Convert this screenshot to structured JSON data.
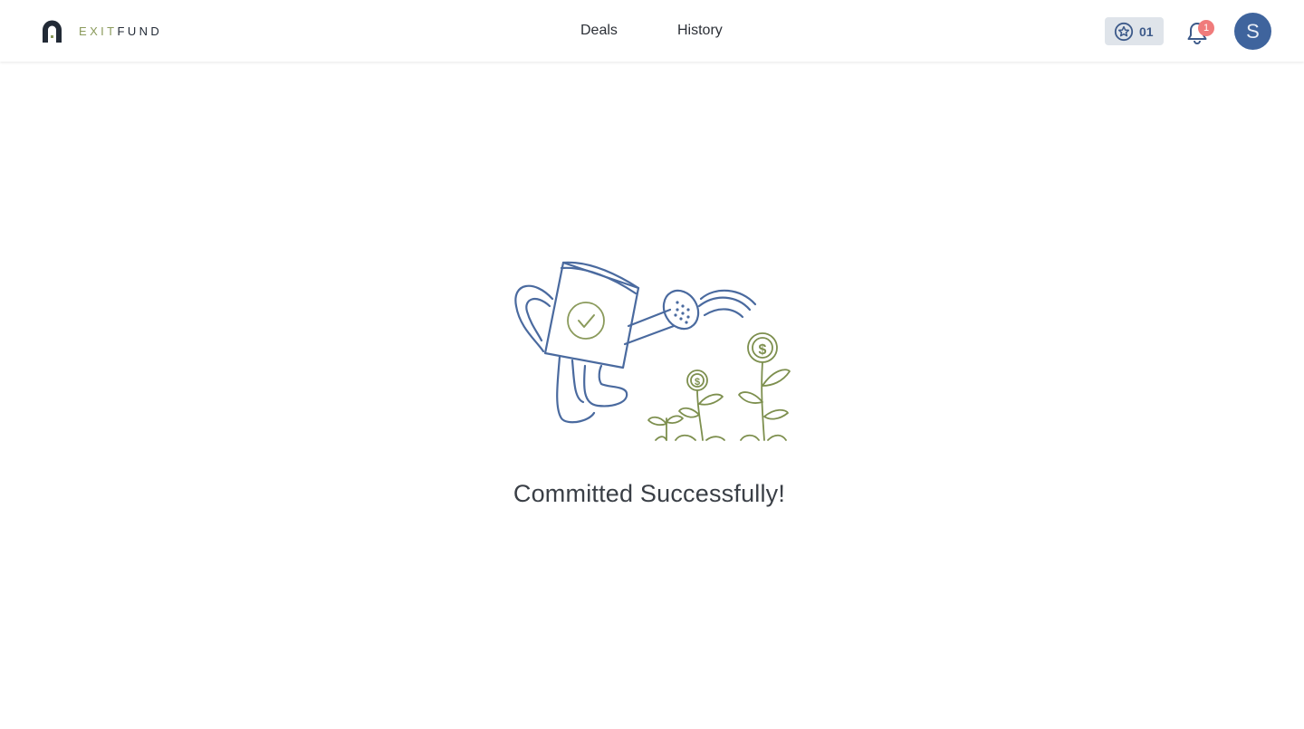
{
  "header": {
    "logo": {
      "brand_part1": "EXIT",
      "brand_part2": "FUND"
    },
    "nav": [
      {
        "label": "Deals"
      },
      {
        "label": "History"
      }
    ],
    "points": {
      "value": "01",
      "icon": "star-badge-icon"
    },
    "notifications": {
      "count": "1",
      "icon": "bell-icon"
    },
    "avatar": {
      "initial": "S"
    }
  },
  "main": {
    "illustration": "watering-can-with-money-plants",
    "message": "Committed Successfully!"
  },
  "colors": {
    "brand_navy": "#3f649d",
    "brand_olive": "#8a9a5b",
    "badge_red": "#f07b7b",
    "chip_bg": "#dfe4ea"
  }
}
